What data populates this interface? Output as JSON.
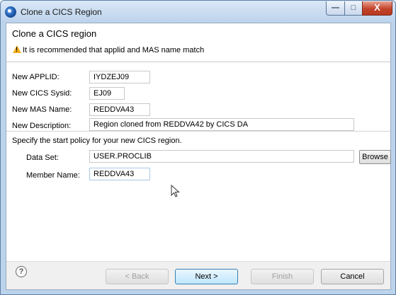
{
  "window": {
    "title": "Clone a CICS Region",
    "minimize_glyph": "—",
    "maximize_glyph": "□",
    "close_glyph": "X"
  },
  "header": {
    "title": "Clone a CICS region",
    "warning_icon": "warning-icon",
    "message": "It is recommended that applid and MAS name match"
  },
  "form": {
    "applid_label": "New APPLID:",
    "applid_value": "IYDZEJ09",
    "sysid_label": "New CICS Sysid:",
    "sysid_value": "EJ09",
    "mas_label": "New MAS Name:",
    "mas_value": "REDDVA43",
    "desc_label": "New Description:",
    "desc_value": "Region cloned from REDDVA42  by CICS DA",
    "start_policy_text": "Specify the start policy for your new CICS region.",
    "dataset_label": "Data Set:",
    "dataset_value": "USER.PROCLIB",
    "browse_label": "Browse",
    "member_label": "Member Name:",
    "member_value": "REDDVA43"
  },
  "footer": {
    "help_glyph": "?",
    "back_label": "< Back",
    "next_label": "Next >",
    "finish_label": "Finish",
    "cancel_label": "Cancel"
  },
  "colors": {
    "window_frame": "#bcd3ec",
    "close_button": "#c4432a",
    "warning": "#f2b01e",
    "primary_button": "#bee6fd"
  }
}
